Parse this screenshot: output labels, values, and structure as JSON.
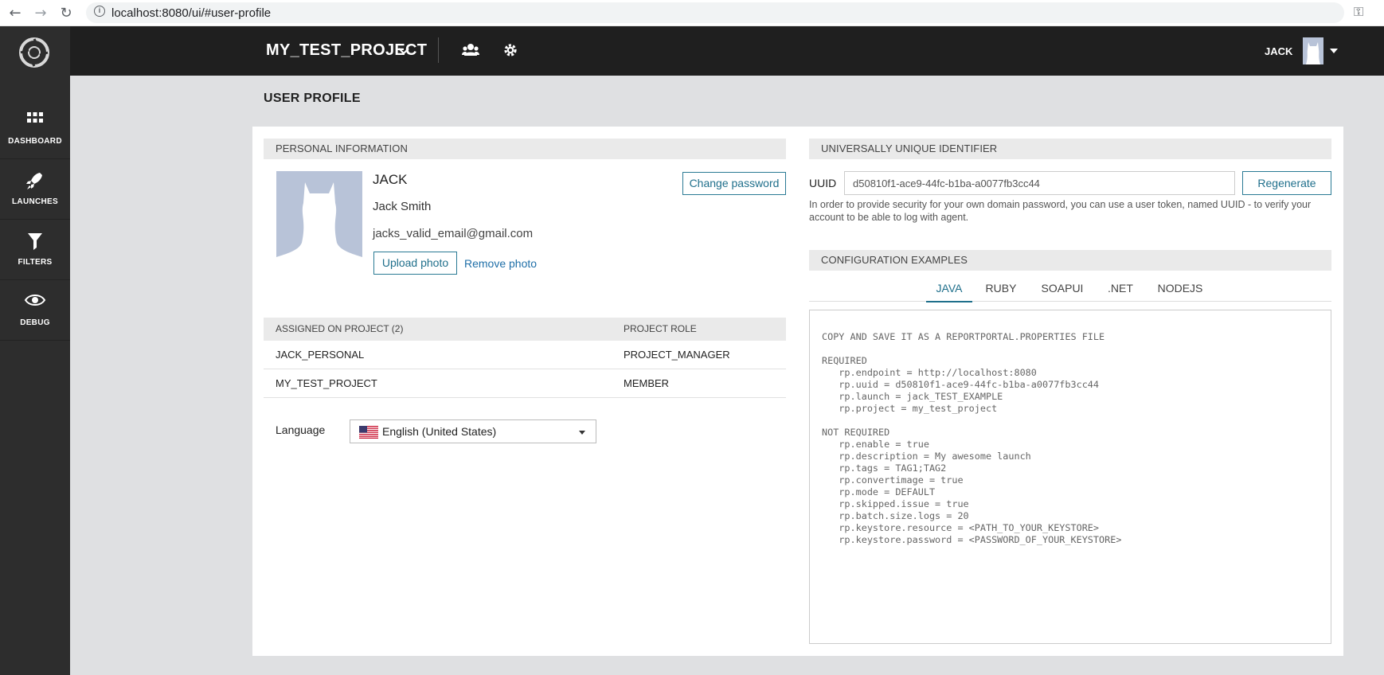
{
  "browser": {
    "url": "localhost:8080/ui/#user-profile"
  },
  "sidebar": {
    "items": [
      {
        "label": "DASHBOARD"
      },
      {
        "label": "LAUNCHES"
      },
      {
        "label": "FILTERS"
      },
      {
        "label": "DEBUG"
      }
    ]
  },
  "header": {
    "project": "MY_TEST_PROJECT",
    "user": "JACK"
  },
  "page": {
    "title": "USER PROFILE"
  },
  "personal": {
    "header": "PERSONAL INFORMATION",
    "username": "JACK",
    "full_name": "Jack Smith",
    "email": "jacks_valid_email@gmail.com",
    "change_password": "Change password",
    "upload_photo": "Upload photo",
    "remove_photo": "Remove photo"
  },
  "projects": {
    "col_project": "ASSIGNED ON PROJECT (2)",
    "col_role": "PROJECT ROLE",
    "rows": [
      {
        "project": "JACK_PERSONAL",
        "role": "PROJECT_MANAGER"
      },
      {
        "project": "MY_TEST_PROJECT",
        "role": "MEMBER"
      }
    ]
  },
  "language": {
    "label": "Language",
    "selected": "English (United States)"
  },
  "uuid": {
    "header": "UNIVERSALLY UNIQUE IDENTIFIER",
    "label": "UUID",
    "value": "d50810f1-ace9-44fc-b1ba-a0077fb3cc44",
    "regenerate": "Regenerate",
    "help": "In order to provide security for your own domain password, you can use a user token, named UUID - to verify your account to be able to log with agent."
  },
  "config": {
    "header": "CONFIGURATION EXAMPLES",
    "tabs": [
      "JAVA",
      "RUBY",
      "SOAPUI",
      ".NET",
      "NODEJS"
    ],
    "active_tab": "JAVA",
    "code": "COPY AND SAVE IT AS A REPORTPORTAL.PROPERTIES FILE\n\nREQUIRED\n   rp.endpoint = http://localhost:8080\n   rp.uuid = d50810f1-ace9-44fc-b1ba-a0077fb3cc44\n   rp.launch = jack_TEST_EXAMPLE\n   rp.project = my_test_project\n\nNOT REQUIRED\n   rp.enable = true\n   rp.description = My awesome launch\n   rp.tags = TAG1;TAG2\n   rp.convertimage = true\n   rp.mode = DEFAULT\n   rp.skipped.issue = true\n   rp.batch.size.logs = 20\n   rp.keystore.resource = <PATH_TO_YOUR_KEYSTORE>\n   rp.keystore.password = <PASSWORD_OF_YOUR_KEYSTORE>"
  },
  "colors": {
    "sidebar": "#2d2d2d",
    "topbar": "#1f1f1f",
    "accent": "#1f6f8b",
    "avatar_bg": "#b8c3d8"
  }
}
